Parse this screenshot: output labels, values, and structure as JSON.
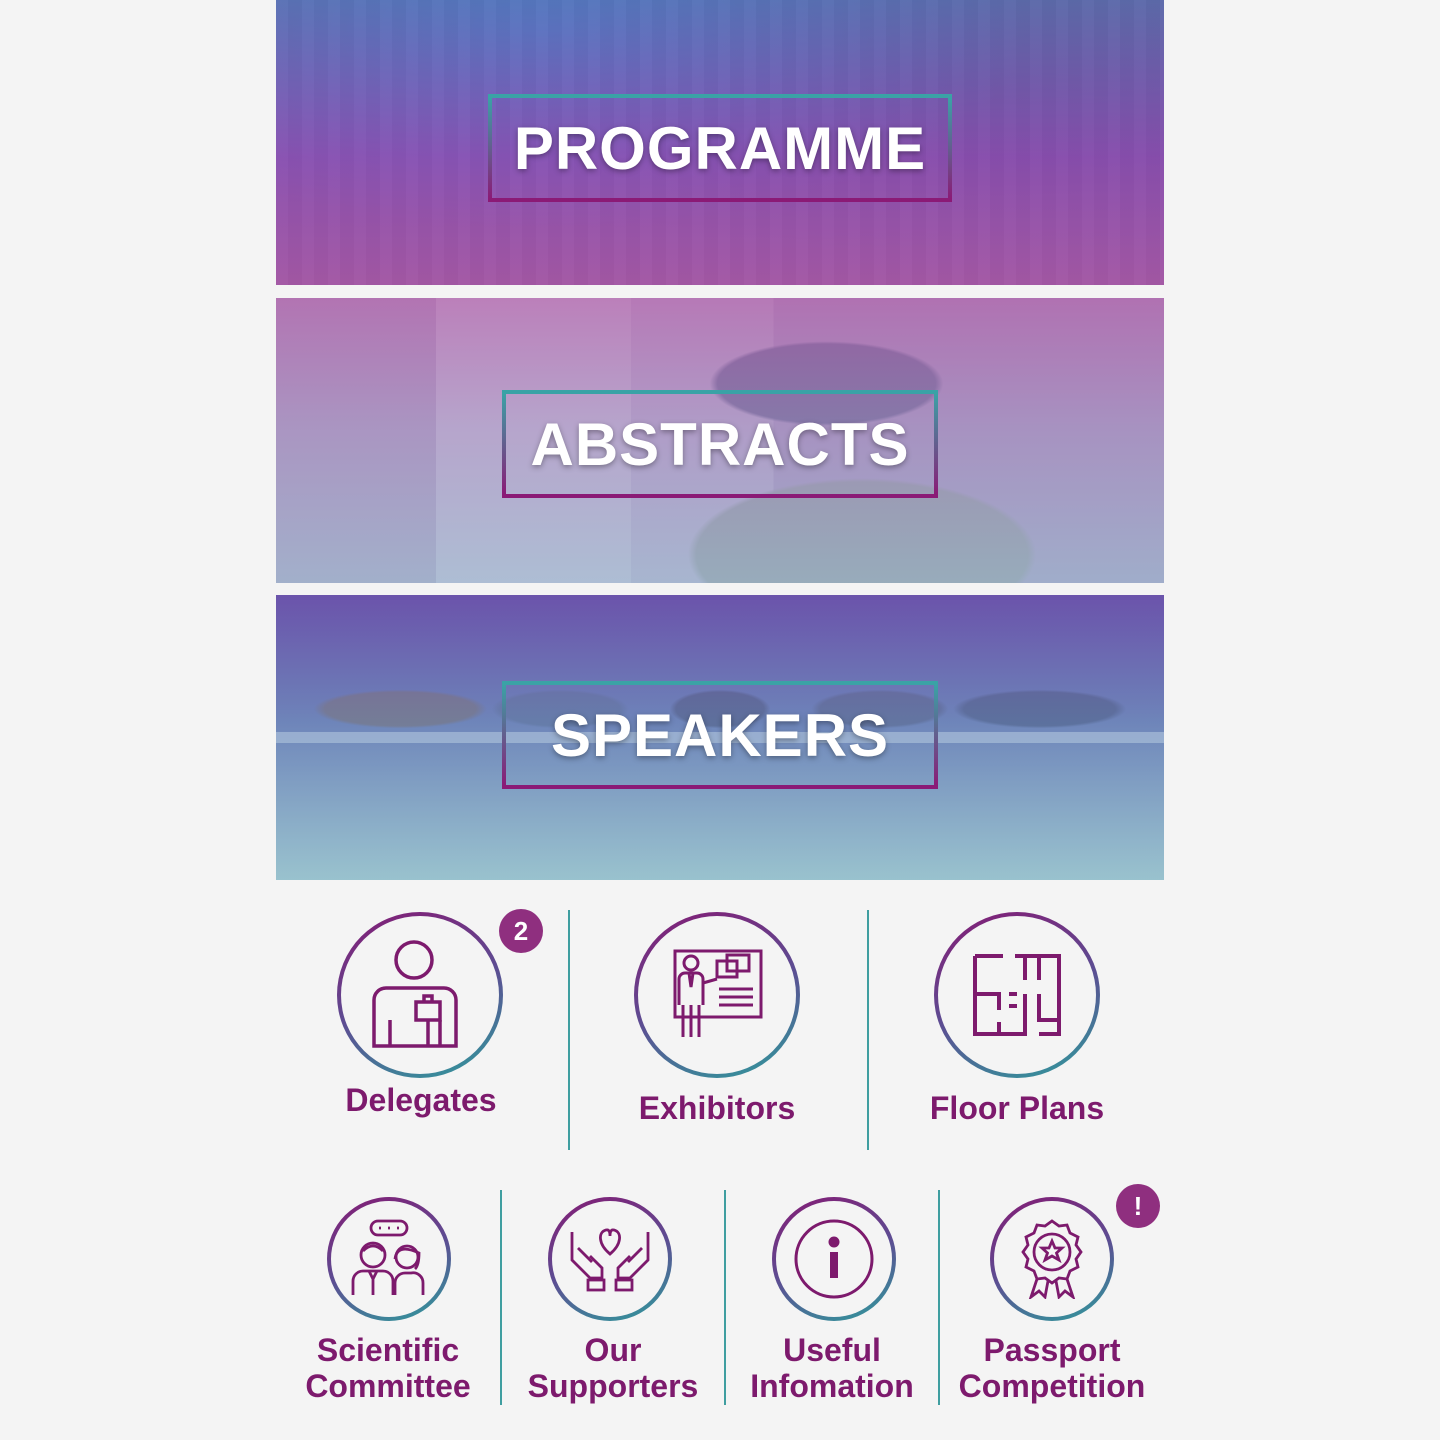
{
  "banners": [
    {
      "label": "PROGRAMME"
    },
    {
      "label": "ABSTRACTS"
    },
    {
      "label": "SPEAKERS"
    }
  ],
  "tiles_row1": [
    {
      "label": "Delegates",
      "icon": "person-badge-icon",
      "badge": "2"
    },
    {
      "label": "Exhibitors",
      "icon": "presenter-board-icon"
    },
    {
      "label": "Floor Plans",
      "icon": "floor-plan-icon"
    }
  ],
  "tiles_row2": [
    {
      "label_line1": "Scientific",
      "label_line2": "Committee",
      "icon": "people-chat-icon"
    },
    {
      "label_line1": "Our",
      "label_line2": "Supporters",
      "icon": "hands-heart-icon"
    },
    {
      "label_line1": "Useful",
      "label_line2": "Infomation",
      "icon": "info-icon"
    },
    {
      "label_line1": "Passport",
      "label_line2": "Competition",
      "icon": "award-rosette-icon",
      "badge": "!"
    }
  ],
  "colors": {
    "accent_purple": "#7d1a6d",
    "accent_teal": "#3aa3a6",
    "badge": "#8f2f7f",
    "background": "#f4f4f4"
  }
}
